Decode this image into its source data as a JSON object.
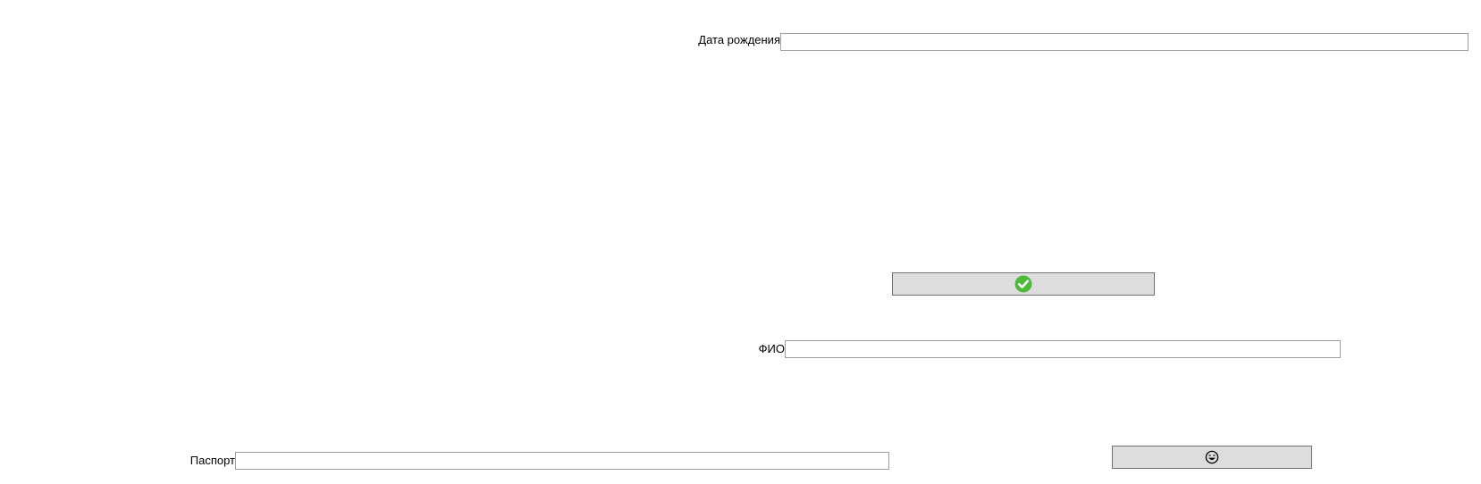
{
  "form": {
    "birth_date": {
      "label": "Дата рождения",
      "value": ""
    },
    "full_name": {
      "label": "ФИО",
      "value": ""
    },
    "passport": {
      "label": "Паспорт",
      "value": ""
    },
    "confirm_button": {
      "icon": "check-circle-icon",
      "icon_color": "#4cbb3a"
    },
    "secondary_button": {
      "icon": "emoji-face-icon"
    }
  },
  "colors": {
    "button_background": "#dddddd",
    "input_border": "#a0a0a0"
  }
}
